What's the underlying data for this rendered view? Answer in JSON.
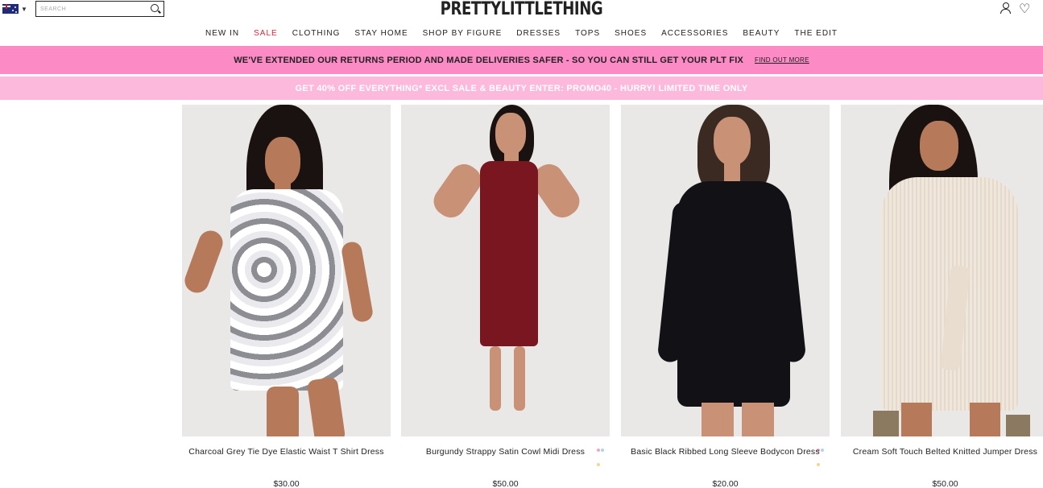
{
  "header": {
    "brand": "PRETTYLITTLETHING",
    "search_placeholder": "SEARCH",
    "country_flag": "australia-flag-icon"
  },
  "nav": {
    "items": [
      {
        "label": "NEW IN"
      },
      {
        "label": "SALE",
        "color": "#e0243b"
      },
      {
        "label": "CLOTHING"
      },
      {
        "label": "STAY HOME"
      },
      {
        "label": "SHOP BY FIGURE"
      },
      {
        "label": "DRESSES"
      },
      {
        "label": "TOPS"
      },
      {
        "label": "SHOES"
      },
      {
        "label": "ACCESSORIES"
      },
      {
        "label": "BEAUTY"
      },
      {
        "label": "THE EDIT"
      }
    ]
  },
  "banners": {
    "returns": {
      "message": "WE'VE EXTENDED OUR RETURNS PERIOD AND MADE DELIVERIES SAFER - SO YOU CAN STILL GET YOUR PLT FIX",
      "link": "FIND OUT MORE",
      "color": "#fc8bc5"
    },
    "promo": {
      "message": "GET 40% OFF EVERYTHING* EXCL SALE & BEAUTY ENTER: PROMO40 - HURRY! LIMITED TIME ONLY",
      "color": "#fdb9dc"
    }
  },
  "products": [
    {
      "name": "Charcoal Grey Tie Dye Elastic Waist T Shirt Dress",
      "price": "$30.00",
      "image": "model-grey-tie-dye-dress",
      "dress_color": "#d7d7da"
    },
    {
      "name": "Burgundy Strappy Satin Cowl Midi Dress",
      "price": "$50.00",
      "image": "model-burgundy-midi-dress",
      "dress_color": "#7a1620"
    },
    {
      "name": "Basic Black Ribbed Long Sleeve Bodycon Dress",
      "price": "$20.00",
      "image": "model-black-bodycon-dress",
      "dress_color": "#121216"
    },
    {
      "name": "Cream Soft Touch Belted Knitted Jumper Dress",
      "price": "$50.00",
      "image": "model-cream-jumper-dress",
      "dress_color": "#efe6dc"
    }
  ]
}
